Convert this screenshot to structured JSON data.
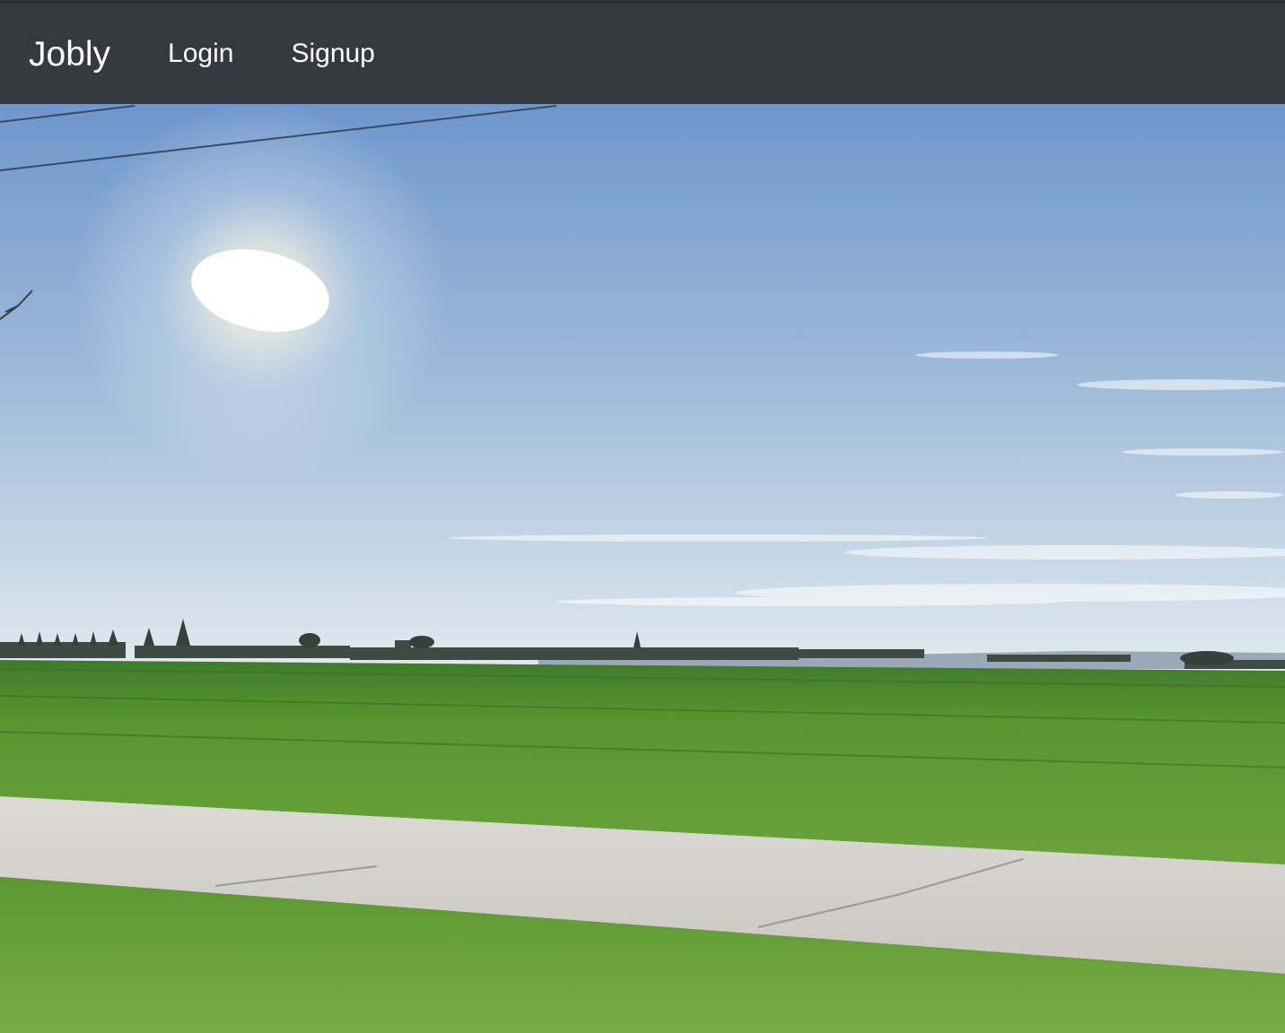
{
  "navbar": {
    "brand": "Jobly",
    "links": [
      {
        "label": "Login"
      },
      {
        "label": "Signup"
      }
    ]
  },
  "colors": {
    "navbar_bg": "#343a40",
    "nav_text": "#ffffff",
    "sky_top": "#6f97cc",
    "sky_horizon": "#dfe8ee",
    "field_green": "#5e9a2c",
    "road": "#d3d1cb"
  }
}
